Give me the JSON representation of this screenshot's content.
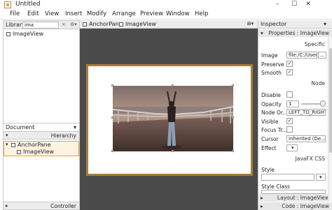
{
  "window": {
    "title": "Untitled",
    "controls": {
      "minimize": "–",
      "maximize": "☐",
      "close": "✕"
    }
  },
  "menu": [
    "File",
    "Edit",
    "View",
    "Insert",
    "Modify",
    "Arrange",
    "Preview",
    "Window",
    "Help"
  ],
  "library": {
    "label": "Library",
    "search_value": "ima",
    "clear_glyph": "×",
    "gear_glyph": "⚙▾",
    "items": [
      {
        "label": "ImageView",
        "icon": "image-view-icon"
      }
    ]
  },
  "document": {
    "label": "Document",
    "collapse_glyph": "▾",
    "hierarchy_label": "Hierarchy",
    "tree": [
      {
        "label": "AnchorPane",
        "icon": "anchor-pane-icon",
        "expanded": true
      },
      {
        "label": "ImageView",
        "icon": "image-view-icon"
      }
    ],
    "controller_label": "Controller"
  },
  "canvas": {
    "breadcrumb": [
      {
        "label": "AnchorPane",
        "icon": "anchor-pane-icon"
      },
      {
        "label": "ImageView",
        "icon": "image-view-icon"
      }
    ],
    "menu_glyph": "⊞▾",
    "photo": "woman-on-pier-photo"
  },
  "inspector": {
    "label": "Inspector",
    "sections": {
      "properties": "Properties : ImageView",
      "specific": "Specific",
      "node": "Node",
      "javafx_css": "JavaFX CSS",
      "layout": "Layout : ImageView",
      "code": "Code : ImageView"
    },
    "props": {
      "image_label": "Image",
      "image_value": "file:/C:/Users/",
      "image_button": "...",
      "preserve_label": "Preserve ...",
      "preserve_checked": true,
      "smooth_label": "Smooth",
      "smooth_checked": true,
      "disable_label": "Disable",
      "disable_checked": false,
      "opacity_label": "Opacity",
      "opacity_value": "1",
      "node_orientation_label": "Node Or...",
      "node_orientation_value": "LEFT_TO_RIGHT",
      "visible_label": "Visible",
      "visible_checked": true,
      "focus_label": "Focus Tr...",
      "focus_checked": false,
      "cursor_label": "Cursor",
      "cursor_value": "Inherited (De...",
      "effect_label": "Effect",
      "style_label": "Style",
      "style_class_label": "Style Class"
    },
    "check_glyph": "✓",
    "dropdown_glyph": "▾",
    "section_arrow_down": "▾",
    "section_arrow_right": "▸"
  },
  "colors": {
    "canvas_bg": "#4b4b4b",
    "stage_border": "#a87d3a",
    "selection": "#e0a13c"
  }
}
